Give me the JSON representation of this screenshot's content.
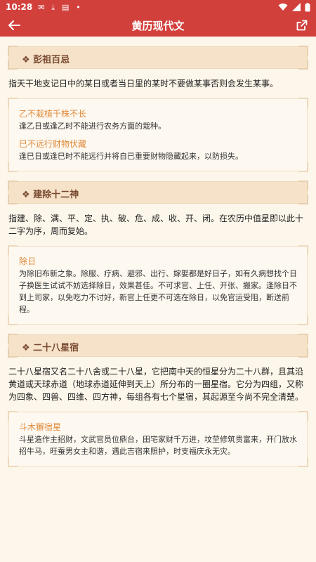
{
  "status_bar": {
    "time": "10:28"
  },
  "app_bar": {
    "title": "黄历现代文"
  },
  "sections": [
    {
      "header": "❖ 彭祖百忌",
      "desc": "指天干地支记日中的某日或者当日里的某时不要做某事否则会发生某事。",
      "items": [
        {
          "title": "乙不栽植千株不长",
          "desc": "逢乙日或逢乙时不能进行农务方面的栽种。"
        },
        {
          "title": "巳不远行财物伏藏",
          "desc": "逢巳日或逢巳时不能远行并将自已重要财物隐藏起来，以防损失。"
        }
      ]
    },
    {
      "header": "❖ 建除十二神",
      "desc": "指建、除、满、平、定、执、破、危、成、收、开、闭。在农历中值星即以此十二字为序，周而复始。",
      "items": [
        {
          "title": "除日",
          "desc": "为除旧布新之象。除服、疗病、避邪、出行、嫁娶都是好日子，如有久病想找个日子换医生试试不妨选择除日，效果甚佳。不可求官、上任、开张、搬家。逢除日不到上司家，以免吃力不讨好，新官上任更不可选在除日，以免官运受阻，断送前程。"
        }
      ]
    },
    {
      "header": "❖ 二十八星宿",
      "desc": "二十八星宿又名二十八舍或二十八星，它把南中天的恒星分为二十八群，且其沿黄道或天球赤道（地球赤道延伸到天上）所分布的一圈星宿。它分为四组，又称为四象、四兽、四维、四方神，每组各有七个星宿，其起源至今尚不完全清楚。",
      "items": [
        {
          "title": "斗木獬宿星",
          "desc": "斗星造作主招财，文武官员位鼎台，田宅家财千万进，坟茔修筑贵富来，开门放水招牛马，旺蚕男女主和谐，遇此吉宿来照护，时支福庆永无灾。"
        }
      ]
    }
  ]
}
